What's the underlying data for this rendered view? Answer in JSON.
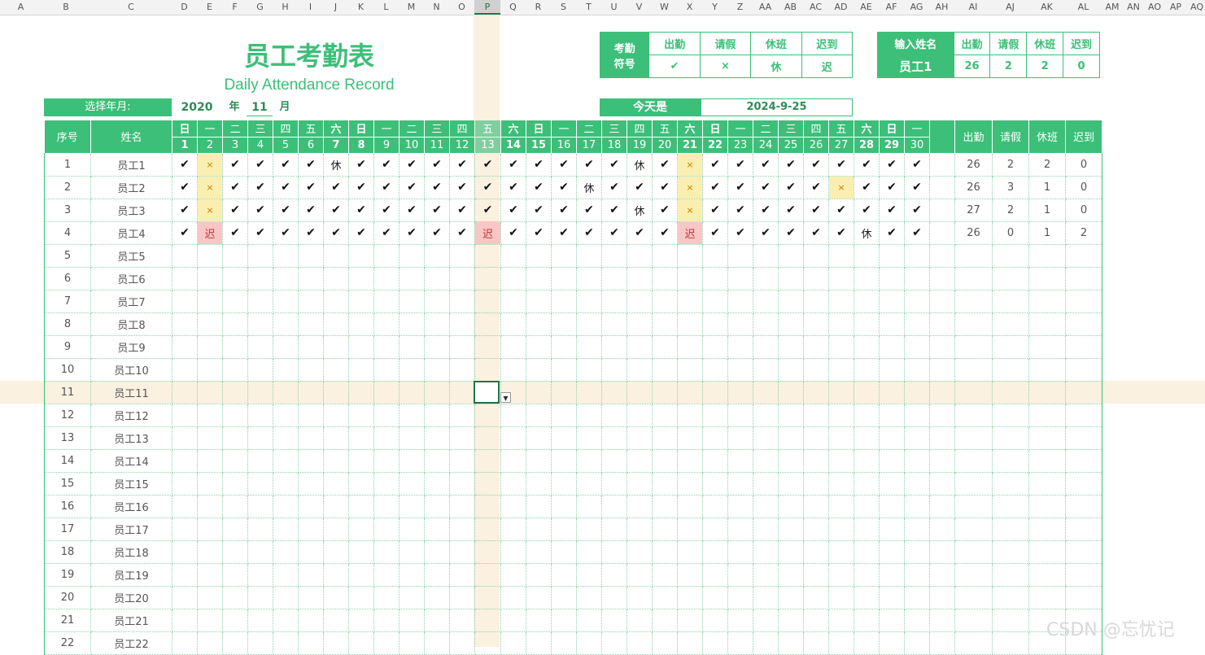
{
  "columns": [
    "A",
    "B",
    "C",
    "D",
    "E",
    "F",
    "G",
    "H",
    "I",
    "J",
    "K",
    "L",
    "M",
    "N",
    "O",
    "P",
    "Q",
    "R",
    "S",
    "T",
    "U",
    "V",
    "W",
    "X",
    "Y",
    "Z",
    "AA",
    "AB",
    "AC",
    "AD",
    "AE",
    "AF",
    "AG",
    "AH",
    "AI",
    "AJ",
    "AK",
    "AL",
    "AM",
    "AN",
    "AO",
    "AP",
    "AQ"
  ],
  "selected_column": "P",
  "title": "员工考勤表",
  "subtitle": "Daily Attendance Record",
  "period": {
    "label": "选择年月:",
    "year": "2020",
    "year_unit": "年",
    "month": "11",
    "month_unit": "月"
  },
  "legend": {
    "label_line1": "考勤",
    "label_line2": "符号",
    "items": [
      {
        "name": "出勤",
        "symbol": "✔"
      },
      {
        "name": "请假",
        "symbol": "×"
      },
      {
        "name": "休班",
        "symbol": "休"
      },
      {
        "name": "迟到",
        "symbol": "迟"
      }
    ]
  },
  "lookup": {
    "label": "输入姓名",
    "name": "员工1",
    "headers": [
      "出勤",
      "请假",
      "休班",
      "迟到"
    ],
    "values": [
      "26",
      "2",
      "2",
      "0"
    ]
  },
  "today": {
    "label": "今天是",
    "value": "2024-9-25"
  },
  "grid": {
    "seq_header": "序号",
    "name_header": "姓名",
    "weekdays": [
      "日",
      "一",
      "二",
      "三",
      "四",
      "五",
      "六",
      "日",
      "一",
      "二",
      "三",
      "四",
      "五",
      "六",
      "日",
      "一",
      "二",
      "三",
      "四",
      "五",
      "六",
      "日",
      "一",
      "二",
      "三",
      "四",
      "五",
      "六",
      "日",
      "一"
    ],
    "days": [
      "1",
      "2",
      "3",
      "4",
      "5",
      "6",
      "7",
      "8",
      "9",
      "10",
      "11",
      "12",
      "13",
      "14",
      "15",
      "16",
      "17",
      "18",
      "19",
      "20",
      "21",
      "22",
      "23",
      "24",
      "25",
      "26",
      "27",
      "28",
      "29",
      "30"
    ],
    "summary_headers": [
      "出勤",
      "请假",
      "休班",
      "迟到"
    ],
    "rows": [
      {
        "seq": "1",
        "name": "员工1",
        "marks": [
          "✔",
          "×",
          "✔",
          "✔",
          "✔",
          "✔",
          "休",
          "✔",
          "✔",
          "✔",
          "✔",
          "✔",
          "✔",
          "✔",
          "✔",
          "✔",
          "✔",
          "✔",
          "休",
          "✔",
          "×",
          "✔",
          "✔",
          "✔",
          "✔",
          "✔",
          "✔",
          "✔",
          "✔",
          "✔"
        ],
        "summary": [
          "26",
          "2",
          "2",
          "0"
        ]
      },
      {
        "seq": "2",
        "name": "员工2",
        "marks": [
          "✔",
          "×",
          "✔",
          "✔",
          "✔",
          "✔",
          "✔",
          "✔",
          "✔",
          "✔",
          "✔",
          "✔",
          "✔",
          "✔",
          "✔",
          "✔",
          "休",
          "✔",
          "✔",
          "✔",
          "×",
          "✔",
          "✔",
          "✔",
          "✔",
          "✔",
          "×",
          "✔",
          "✔",
          "✔"
        ],
        "summary": [
          "26",
          "3",
          "1",
          "0"
        ]
      },
      {
        "seq": "3",
        "name": "员工3",
        "marks": [
          "✔",
          "×",
          "✔",
          "✔",
          "✔",
          "✔",
          "✔",
          "✔",
          "✔",
          "✔",
          "✔",
          "✔",
          "✔",
          "✔",
          "✔",
          "✔",
          "✔",
          "✔",
          "休",
          "✔",
          "×",
          "✔",
          "✔",
          "✔",
          "✔",
          "✔",
          "✔",
          "✔",
          "✔",
          "✔"
        ],
        "summary": [
          "27",
          "2",
          "1",
          "0"
        ]
      },
      {
        "seq": "4",
        "name": "员工4",
        "marks": [
          "✔",
          "迟",
          "✔",
          "✔",
          "✔",
          "✔",
          "✔",
          "✔",
          "✔",
          "✔",
          "✔",
          "✔",
          "迟",
          "✔",
          "✔",
          "✔",
          "✔",
          "✔",
          "✔",
          "✔",
          "迟",
          "✔",
          "✔",
          "✔",
          "✔",
          "✔",
          "✔",
          "休",
          "✔",
          "✔"
        ],
        "summary": [
          "26",
          "0",
          "1",
          "2"
        ]
      },
      {
        "seq": "5",
        "name": "员工5",
        "marks": [],
        "summary": []
      },
      {
        "seq": "6",
        "name": "员工6",
        "marks": [],
        "summary": []
      },
      {
        "seq": "7",
        "name": "员工7",
        "marks": [],
        "summary": []
      },
      {
        "seq": "8",
        "name": "员工8",
        "marks": [],
        "summary": []
      },
      {
        "seq": "9",
        "name": "员工9",
        "marks": [],
        "summary": []
      },
      {
        "seq": "10",
        "name": "员工10",
        "marks": [],
        "summary": []
      },
      {
        "seq": "11",
        "name": "员工11",
        "marks": [],
        "summary": []
      },
      {
        "seq": "12",
        "name": "员工12",
        "marks": [],
        "summary": []
      },
      {
        "seq": "13",
        "name": "员工13",
        "marks": [],
        "summary": []
      },
      {
        "seq": "14",
        "name": "员工14",
        "marks": [],
        "summary": []
      },
      {
        "seq": "15",
        "name": "员工15",
        "marks": [],
        "summary": []
      },
      {
        "seq": "16",
        "name": "员工16",
        "marks": [],
        "summary": []
      },
      {
        "seq": "17",
        "name": "员工17",
        "marks": [],
        "summary": []
      },
      {
        "seq": "18",
        "name": "员工18",
        "marks": [],
        "summary": []
      },
      {
        "seq": "19",
        "name": "员工19",
        "marks": [],
        "summary": []
      },
      {
        "seq": "20",
        "name": "员工20",
        "marks": [],
        "summary": []
      },
      {
        "seq": "21",
        "name": "员工21",
        "marks": [],
        "summary": []
      },
      {
        "seq": "22",
        "name": "员工22",
        "marks": [],
        "summary": []
      }
    ]
  },
  "watermark": "CSDN @忘忧记"
}
